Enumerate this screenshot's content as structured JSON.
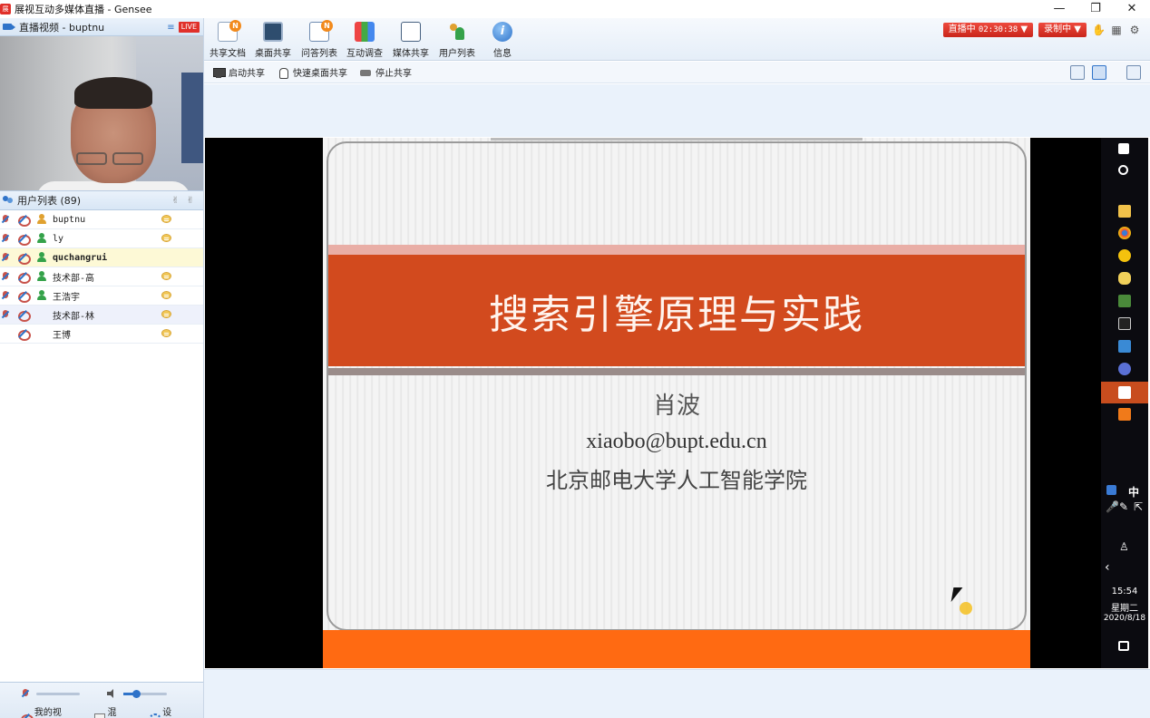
{
  "window": {
    "logo": "展",
    "title": "展视互动多媒体直播 - Gensee",
    "controls": {
      "minimize": "—",
      "restore": "❐",
      "close": "✕"
    }
  },
  "video_panel": {
    "title": "直播视频 - buptnu",
    "live_badge": "LIVE",
    "list_icon": "≡"
  },
  "users_panel": {
    "title": "用户列表 (89)",
    "header_icons": [
      "✌",
      "✌"
    ],
    "users": [
      {
        "name": "buptnu",
        "role": "host",
        "mic": "on",
        "bold": false
      },
      {
        "name": "ly",
        "role": "user",
        "mic": "off",
        "bold": false
      },
      {
        "name": "quchangrui",
        "role": "user",
        "mic": "off",
        "bold": true
      },
      {
        "name": "技术部-高",
        "role": "user",
        "mic": "off",
        "bold": false
      },
      {
        "name": "王浩宇",
        "role": "user",
        "mic": "off",
        "bold": false
      },
      {
        "name": "技术部-林",
        "role": "none",
        "mic": "off",
        "bold": false
      },
      {
        "name": "王博",
        "role": "none",
        "mic": "none",
        "bold": false
      }
    ]
  },
  "footer": {
    "my_video": "我的视频",
    "mix": "混音",
    "settings": "设置",
    "mix_glyph": "W"
  },
  "toolbar": {
    "items": [
      {
        "label": "共享文档",
        "icon": "shared-doc-icon",
        "badge": "N"
      },
      {
        "label": "桌面共享",
        "icon": "desktop-share-icon",
        "badge": ""
      },
      {
        "label": "问答列表",
        "icon": "qa-list-icon",
        "badge": "N"
      },
      {
        "label": "互动调查",
        "icon": "survey-icon",
        "badge": ""
      },
      {
        "label": "媒体共享",
        "icon": "media-share-icon",
        "badge": ""
      },
      {
        "label": "用户列表",
        "icon": "user-list-icon",
        "badge": ""
      },
      {
        "label": "信息",
        "icon": "info-icon",
        "badge": ""
      }
    ],
    "info_glyph": "i",
    "live_status": "直播中",
    "live_time": "02:30:38",
    "record_status": "录制中",
    "dropdown_glyph": "▼",
    "hand_glyph": "✋",
    "grid_glyph": "▦",
    "gear_glyph": "⚙"
  },
  "subbar": {
    "start_share": "启动共享",
    "quick_share": "快速桌面共享",
    "stop_share": "停止共享"
  },
  "slide": {
    "title": "搜索引擎原理与实践",
    "author": "肖波",
    "email": "xiaobo@bupt.edu.cn",
    "institution": "北京邮电大学人工智能学院"
  },
  "taskbar": {
    "ime": "中",
    "time": "15:54",
    "weekday": "星期二",
    "date": "2020/8/18"
  },
  "colors": {
    "accent": "#2f73c9",
    "live_red": "#e0302a",
    "slide_title_band": "#d24a1e",
    "slide_bottom": "#ff6a12"
  }
}
